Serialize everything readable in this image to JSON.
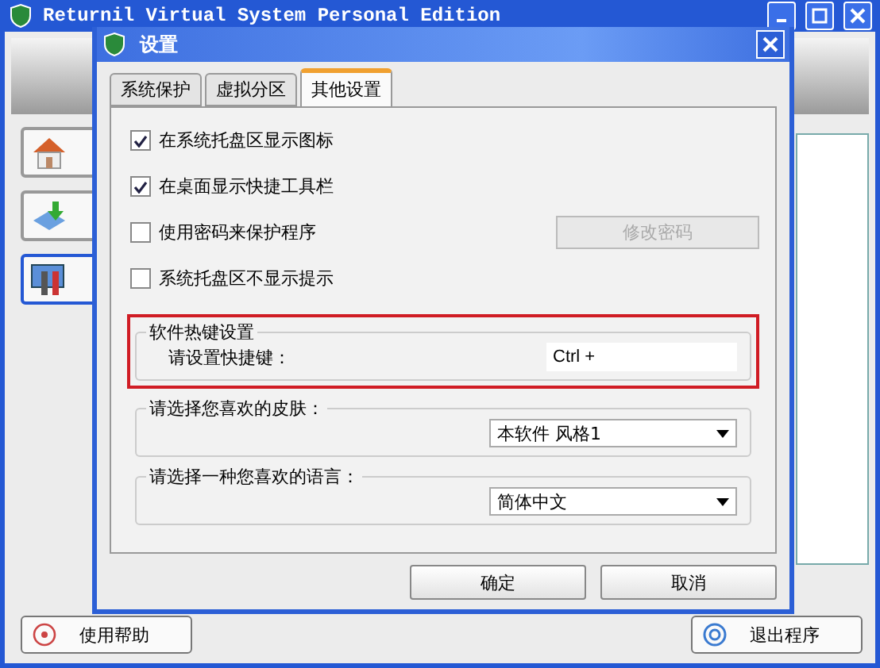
{
  "main_window": {
    "title": "Returnil Virtual System Personal Edition",
    "sidebar": [
      {
        "kind": "home",
        "selected": false
      },
      {
        "kind": "install",
        "selected": false
      },
      {
        "kind": "tools",
        "selected": true
      }
    ],
    "buttons": [
      {
        "kind": "help",
        "label": "使用帮助"
      },
      {
        "kind": "exit",
        "label": "退出程序"
      }
    ]
  },
  "dialog": {
    "title": "设置",
    "tabs": [
      {
        "label": "系统保护",
        "selected": false
      },
      {
        "label": "虚拟分区",
        "selected": false
      },
      {
        "label": "其他设置",
        "selected": true
      }
    ],
    "options": [
      {
        "label": "在系统托盘区显示图标",
        "checked": true
      },
      {
        "label": "在桌面显示快捷工具栏",
        "checked": true
      },
      {
        "label": "使用密码来保护程序",
        "checked": false
      },
      {
        "label": "系统托盘区不显示提示",
        "checked": false
      }
    ],
    "password_button": {
      "label": "修改密码",
      "disabled": true
    },
    "hotkey": {
      "title": "软件热键设置",
      "label": "请设置快捷键：",
      "value": "Ctrl +",
      "highlighted": true
    },
    "skin": {
      "title": "请选择您喜欢的皮肤：",
      "value": "本软件 风格1"
    },
    "language": {
      "title": "请选择一种您喜欢的语言：",
      "value": "简体中文"
    },
    "buttons": [
      "确定",
      "取消"
    ]
  }
}
